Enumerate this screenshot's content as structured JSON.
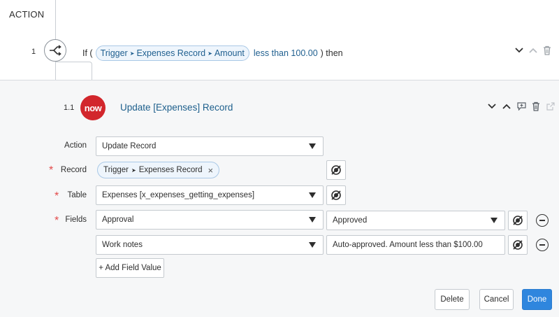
{
  "section": {
    "title": "ACTION"
  },
  "step1": {
    "number": "1",
    "if_prefix": "If (",
    "pill": {
      "part1": "Trigger",
      "part2": "Expenses Record",
      "part3": "Amount"
    },
    "condition": "less than 100.00",
    "suffix": ") then"
  },
  "substep": {
    "number": "1.1",
    "logo_text": "now",
    "title": "Update [Expenses] Record"
  },
  "form": {
    "action": {
      "label": "Action",
      "value": "Update Record"
    },
    "record": {
      "label": "Record",
      "pill_part1": "Trigger",
      "pill_part2": "Expenses Record",
      "remove": "×"
    },
    "table": {
      "label": "Table",
      "value": "Expenses [x_expenses_getting_expenses]"
    },
    "fields": {
      "label": "Fields",
      "rows": [
        {
          "field": "Approval",
          "value": "Approved"
        },
        {
          "field": "Work notes",
          "value": "Auto-approved. Amount less than $100.00"
        }
      ]
    },
    "required_mark": "*",
    "add_field_label": "+ Add Field Value"
  },
  "footer": {
    "delete": "Delete",
    "cancel": "Cancel",
    "done": "Done"
  },
  "colors": {
    "accent": "#2f86de",
    "title_blue": "#1d5f8c",
    "required": "#e34b4b",
    "logo_red": "#d2262c"
  }
}
